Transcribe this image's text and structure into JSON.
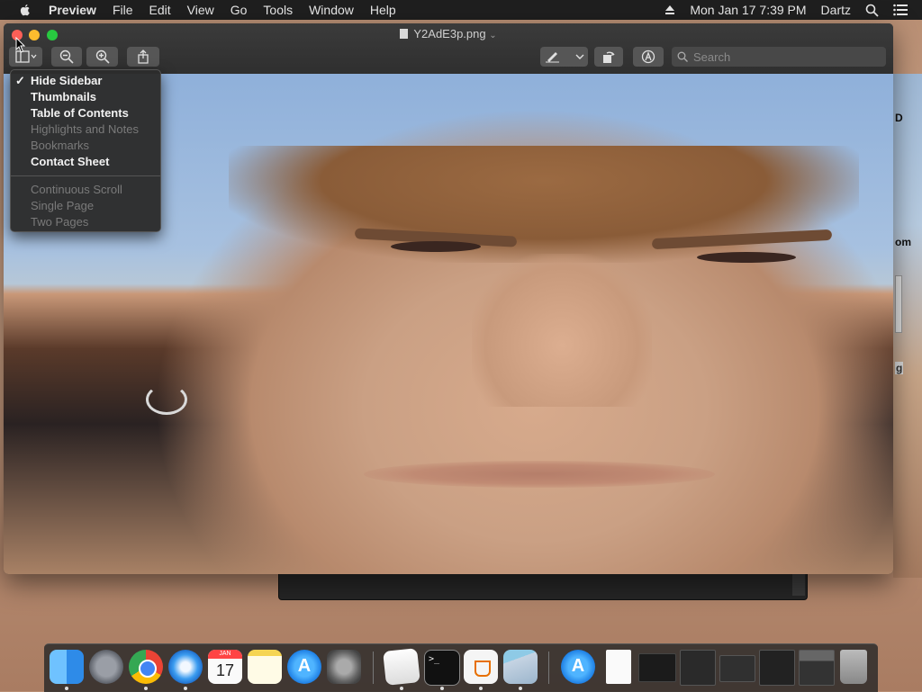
{
  "menubar": {
    "app_name": "Preview",
    "items": [
      "File",
      "Edit",
      "View",
      "Go",
      "Tools",
      "Window",
      "Help"
    ],
    "datetime": "Mon Jan 17  7:39 PM",
    "user": "Dartz"
  },
  "window": {
    "title": "Y2AdE3p.png",
    "search_placeholder": "Search"
  },
  "view_menu": {
    "items": [
      {
        "label": "Hide Sidebar",
        "checked": true,
        "enabled": true
      },
      {
        "label": "Thumbnails",
        "checked": false,
        "enabled": true
      },
      {
        "label": "Table of Contents",
        "checked": false,
        "enabled": true
      },
      {
        "label": "Highlights and Notes",
        "checked": false,
        "enabled": false
      },
      {
        "label": "Bookmarks",
        "checked": false,
        "enabled": false
      },
      {
        "label": "Contact Sheet",
        "checked": false,
        "enabled": true
      }
    ],
    "items2": [
      {
        "label": "Continuous Scroll",
        "enabled": false
      },
      {
        "label": "Single Page",
        "enabled": false
      },
      {
        "label": "Two Pages",
        "enabled": false
      }
    ]
  },
  "background_window": {
    "edge_texts": [
      "D",
      "om",
      "g"
    ]
  },
  "dock": {
    "calendar_month": "JAN",
    "calendar_day": "17",
    "apps": [
      "finder-icon",
      "launchpad-icon",
      "chrome-icon",
      "safari-icon",
      "calendar-icon",
      "notes-icon",
      "app-store-icon",
      "system-preferences-icon",
      "textedit-icon",
      "terminal-icon",
      "java-icon",
      "preview-icon",
      "app-store-download-icon",
      "document-icon",
      "window-thumb-icon",
      "window-thumb-icon",
      "window-thumb-icon",
      "window-thumb-icon",
      "window-thumb-icon",
      "trash-icon"
    ]
  },
  "colors": {
    "menubar_bg": "#1f1f1f",
    "window_bg": "#2b2b2b",
    "close": "#fc5f57",
    "minimize": "#fdbc2e",
    "maximize": "#28c840"
  }
}
